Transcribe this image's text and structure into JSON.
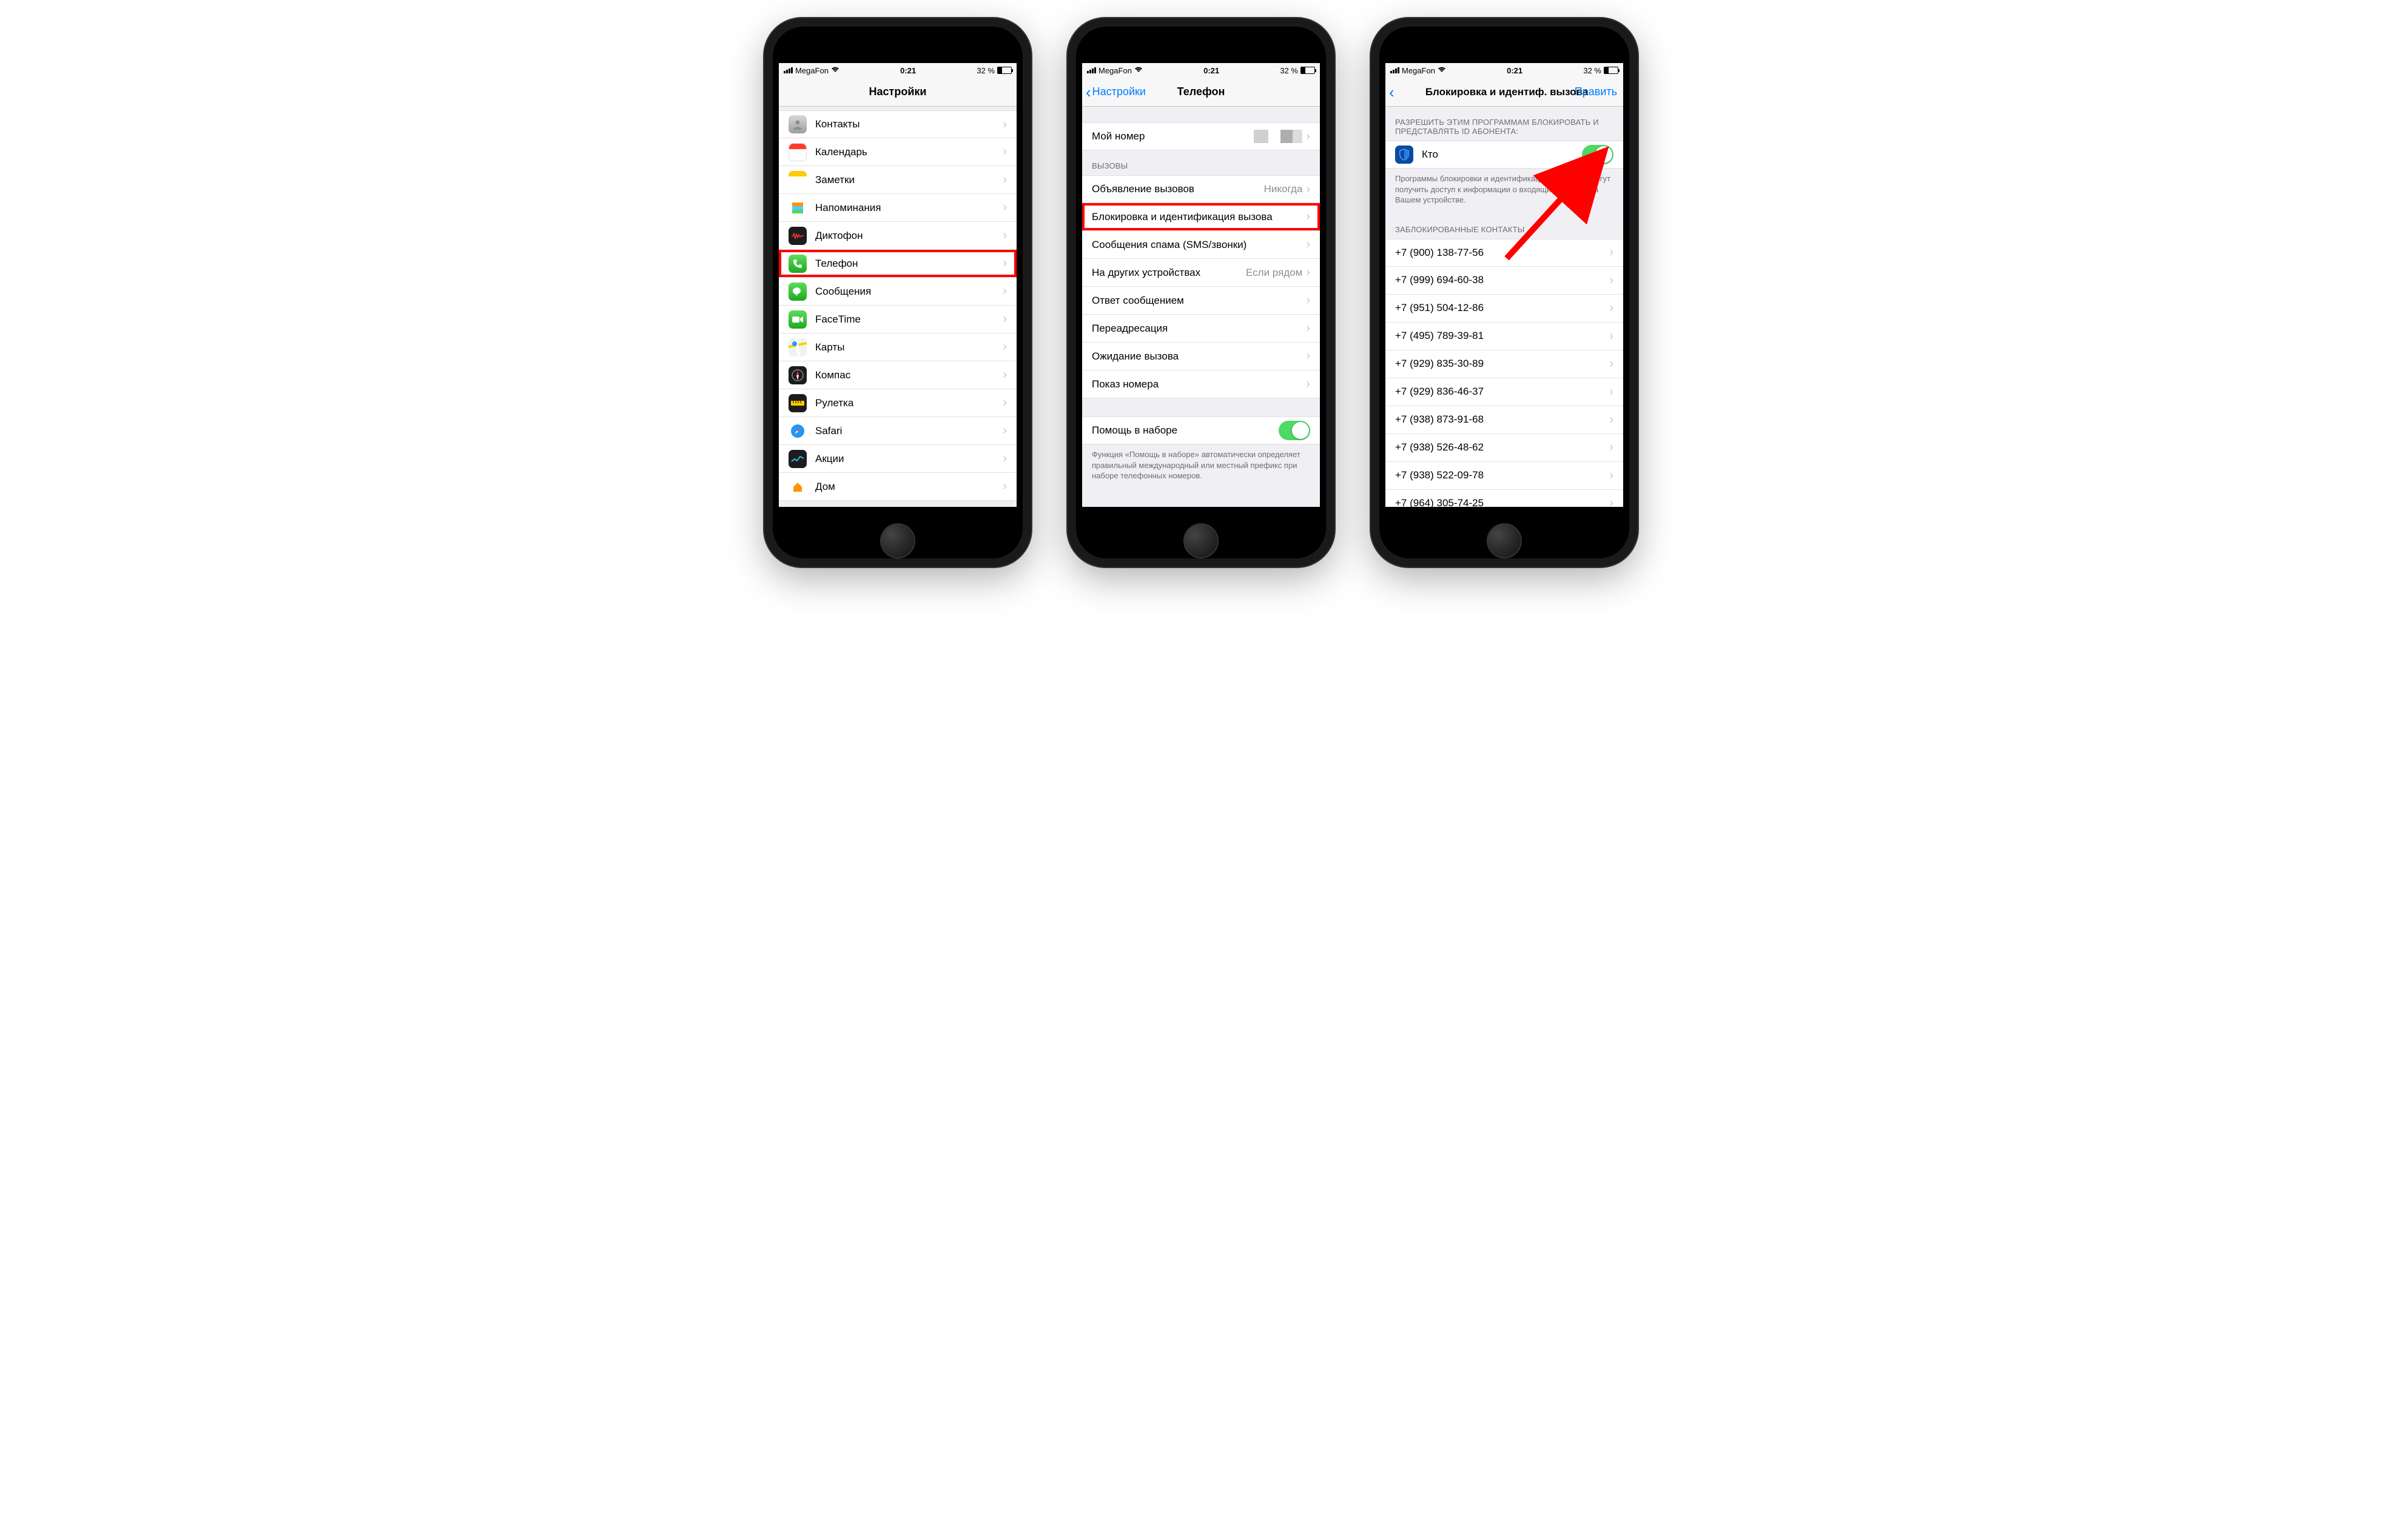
{
  "status": {
    "carrier": "MegaFon",
    "time": "0:21",
    "battery_pct": "32 %"
  },
  "screen1": {
    "title": "Настройки",
    "rows": [
      {
        "label": "Контакты",
        "icon": "contacts"
      },
      {
        "label": "Календарь",
        "icon": "calendar"
      },
      {
        "label": "Заметки",
        "icon": "notes"
      },
      {
        "label": "Напоминания",
        "icon": "reminders"
      },
      {
        "label": "Диктофон",
        "icon": "voice-memo"
      },
      {
        "label": "Телефон",
        "icon": "phone",
        "highlighted": true
      },
      {
        "label": "Сообщения",
        "icon": "messages"
      },
      {
        "label": "FaceTime",
        "icon": "facetime"
      },
      {
        "label": "Карты",
        "icon": "maps"
      },
      {
        "label": "Компас",
        "icon": "compass"
      },
      {
        "label": "Рулетка",
        "icon": "ruler"
      },
      {
        "label": "Safari",
        "icon": "safari"
      },
      {
        "label": "Акции",
        "icon": "stocks"
      },
      {
        "label": "Дом",
        "icon": "home"
      }
    ]
  },
  "screen2": {
    "back": "Настройки",
    "title": "Телефон",
    "my_number_label": "Мой номер",
    "section_calls": "ВЫЗОВЫ",
    "rows_calls": [
      {
        "label": "Объявление вызовов",
        "value": "Никогда"
      },
      {
        "label": "Блокировка и идентификация вызова",
        "highlighted": true
      },
      {
        "label": "Сообщения спама (SMS/звонки)"
      },
      {
        "label": "На других устройствах",
        "value": "Если рядом"
      },
      {
        "label": "Ответ сообщением"
      },
      {
        "label": "Переадресация"
      },
      {
        "label": "Ожидание вызова"
      },
      {
        "label": "Показ номера"
      }
    ],
    "dial_assist_label": "Помощь в наборе",
    "dial_assist_on": true,
    "dial_assist_footer": "Функция «Помощь в наборе» автоматически определяет правильный международный или местный префикс при наборе телефонных номеров."
  },
  "screen3": {
    "title": "Блокировка и идентиф. вызова",
    "edit": "Править",
    "header_allow": "РАЗРЕШИТЬ ЭТИМ ПРОГРАММАМ БЛОКИРОВАТЬ И ПРЕДСТАВЛЯТЬ ID АБОНЕНТА:",
    "app_name": "Кто",
    "app_toggle_on": true,
    "footer_allow": "Программы блокировки и идентификации вызова не могут получить доступ к информации о входящих вызовах на Вашем устройстве.",
    "header_blocked": "ЗАБЛОКИРОВАННЫЕ КОНТАКТЫ",
    "blocked": [
      "+7 (900) 138-77-56",
      "+7 (999) 694-60-38",
      "+7 (951) 504-12-86",
      "+7 (495) 789-39-81",
      "+7 (929) 835-30-89",
      "+7 (929) 836-46-37",
      "+7 (938) 873-91-68",
      "+7 (938) 526-48-62",
      "+7 (938) 522-09-78",
      "+7 (964) 305-74-25"
    ]
  }
}
